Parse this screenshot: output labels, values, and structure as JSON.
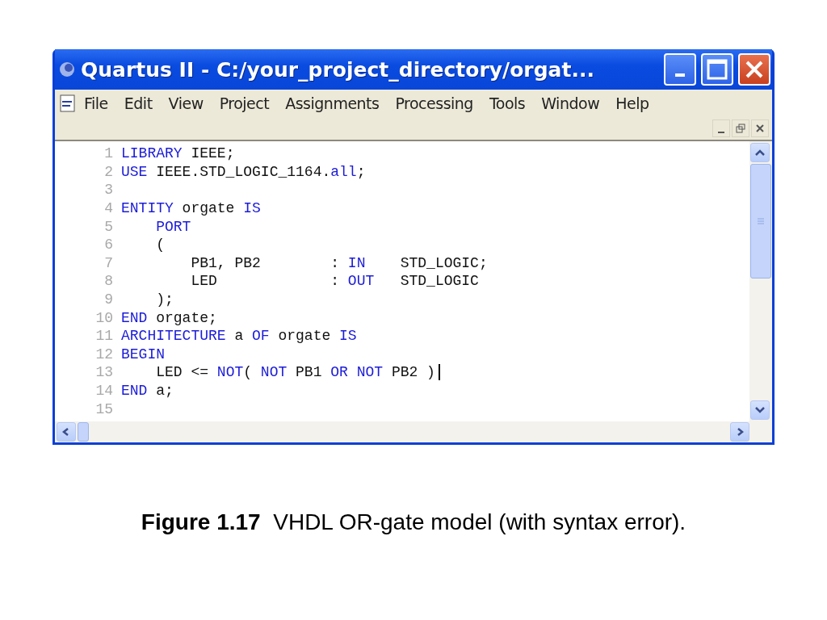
{
  "window": {
    "title": "Quartus II - C:/your_project_directory/orgat..."
  },
  "menu": [
    {
      "label": "File"
    },
    {
      "label": "Edit"
    },
    {
      "label": "View"
    },
    {
      "label": "Project"
    },
    {
      "label": "Assignments"
    },
    {
      "label": "Processing"
    },
    {
      "label": "Tools"
    },
    {
      "label": "Window"
    },
    {
      "label": "Help"
    }
  ],
  "editor": {
    "lines": [
      {
        "number": "1",
        "caret": false,
        "tokens": [
          {
            "kind": "kw",
            "text": "LIBRARY"
          },
          {
            "kind": "plain",
            "text": " IEEE;"
          }
        ]
      },
      {
        "number": "2",
        "caret": false,
        "tokens": [
          {
            "kind": "kw",
            "text": "USE"
          },
          {
            "kind": "plain",
            "text": " IEEE.STD_LOGIC_1164."
          },
          {
            "kind": "kw",
            "text": "all"
          },
          {
            "kind": "plain",
            "text": ";"
          }
        ]
      },
      {
        "number": "3",
        "caret": false
      },
      {
        "number": "4",
        "caret": false,
        "tokens": [
          {
            "kind": "kw",
            "text": "ENTITY"
          },
          {
            "kind": "plain",
            "text": " orgate "
          },
          {
            "kind": "kw",
            "text": "IS"
          }
        ]
      },
      {
        "number": "5",
        "caret": false,
        "tokens": [
          {
            "kind": "kw",
            "text": "    PORT"
          }
        ]
      },
      {
        "number": "6",
        "caret": false,
        "tokens": [
          {
            "kind": "plain",
            "text": "    ("
          }
        ]
      },
      {
        "number": "7",
        "caret": false,
        "tokens": [
          {
            "kind": "plain",
            "text": "        PB1, PB2        : "
          },
          {
            "kind": "kw",
            "text": "IN"
          },
          {
            "kind": "plain",
            "text": "    STD_LOGIC;"
          }
        ]
      },
      {
        "number": "8",
        "caret": false,
        "tokens": [
          {
            "kind": "plain",
            "text": "        LED             : "
          },
          {
            "kind": "kw",
            "text": "OUT"
          },
          {
            "kind": "plain",
            "text": "   STD_LOGIC"
          }
        ]
      },
      {
        "number": "9",
        "caret": false,
        "tokens": [
          {
            "kind": "plain",
            "text": "    );"
          }
        ]
      },
      {
        "number": "10",
        "caret": false,
        "tokens": [
          {
            "kind": "kw",
            "text": "END"
          },
          {
            "kind": "plain",
            "text": " orgate;"
          }
        ]
      },
      {
        "number": "11",
        "caret": false,
        "tokens": [
          {
            "kind": "kw",
            "text": "ARCHITECTURE"
          },
          {
            "kind": "plain",
            "text": " a "
          },
          {
            "kind": "kw",
            "text": "OF"
          },
          {
            "kind": "plain",
            "text": " orgate "
          },
          {
            "kind": "kw",
            "text": "IS"
          }
        ]
      },
      {
        "number": "12",
        "caret": false,
        "tokens": [
          {
            "kind": "kw",
            "text": "BEGIN"
          }
        ]
      },
      {
        "number": "13",
        "caret": true,
        "tokens": [
          {
            "kind": "plain",
            "text": "    LED <= "
          },
          {
            "kind": "kw",
            "text": "NOT"
          },
          {
            "kind": "plain",
            "text": "( "
          },
          {
            "kind": "kw",
            "text": "NOT"
          },
          {
            "kind": "plain",
            "text": " PB1 "
          },
          {
            "kind": "kw",
            "text": "OR NOT"
          },
          {
            "kind": "plain",
            "text": " PB2 )"
          }
        ]
      },
      {
        "number": "14",
        "caret": false,
        "tokens": [
          {
            "kind": "kw",
            "text": "END"
          },
          {
            "kind": "plain",
            "text": " a;"
          }
        ]
      },
      {
        "number": "15",
        "caret": false
      }
    ]
  },
  "caption": "**Figure 1.17**  VHDL OR-gate model (with syntax error)."
}
